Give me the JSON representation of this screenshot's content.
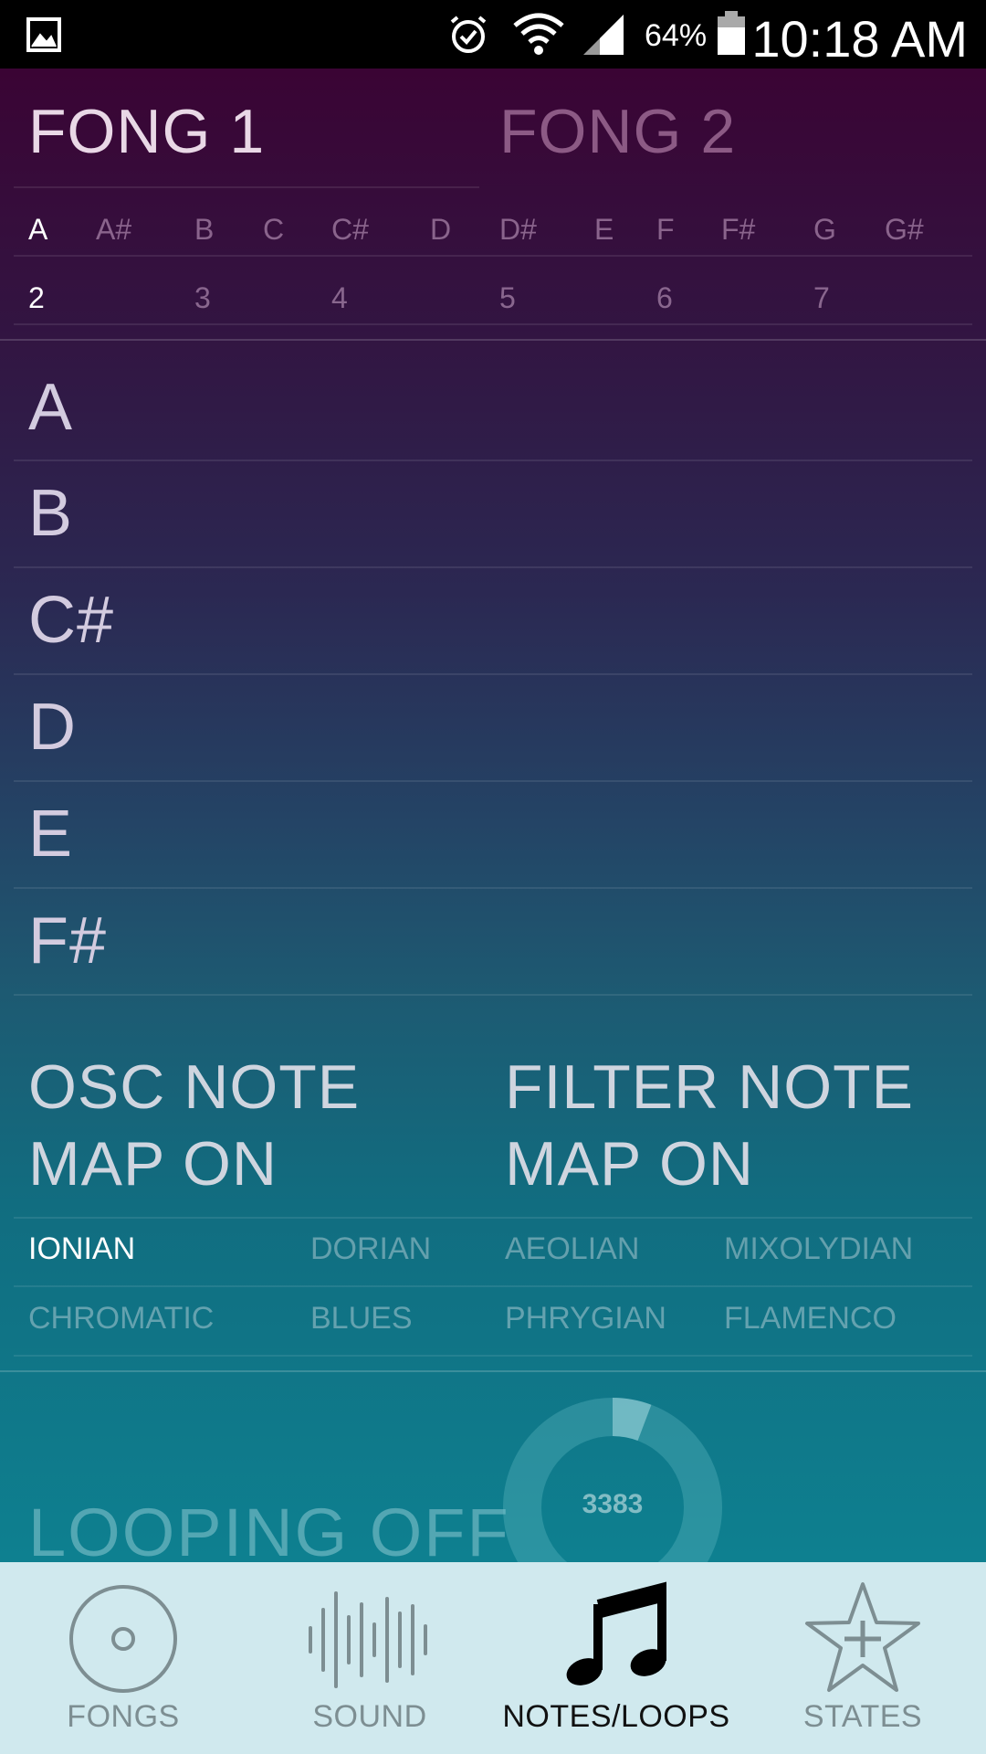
{
  "status_bar": {
    "battery_percent": "64%",
    "time": "10:18 AM"
  },
  "tabs": [
    {
      "label": "FONG 1",
      "selected": true
    },
    {
      "label": "FONG 2",
      "selected": false
    }
  ],
  "keys": [
    "A",
    "A#",
    "B",
    "C",
    "C#",
    "D",
    "D#",
    "E",
    "F",
    "F#",
    "G",
    "G#"
  ],
  "selected_key": "A",
  "octaves": [
    "2",
    "3",
    "4",
    "5",
    "6",
    "7"
  ],
  "selected_octave": "2",
  "notes": [
    "A",
    "B",
    "C#",
    "D",
    "E",
    "F#"
  ],
  "osc_note_map": {
    "line1": "OSC NOTE",
    "line2": "MAP ON"
  },
  "filter_note_map": {
    "line1": "FILTER NOTE",
    "line2": "MAP ON"
  },
  "modes": {
    "row1": [
      "IONIAN",
      "DORIAN",
      "AEOLIAN",
      "MIXOLYDIAN"
    ],
    "row2": [
      "CHROMATIC",
      "BLUES",
      "PHRYGIAN",
      "FLAMENCO"
    ],
    "selected": "IONIAN"
  },
  "looping_label": "LOOPING OFF",
  "dial_value": "3383",
  "nav": [
    {
      "label": "FONGS",
      "icon": "disc-icon",
      "active": false
    },
    {
      "label": "SOUND",
      "icon": "waveform-icon",
      "active": false
    },
    {
      "label": "NOTES/LOOPS",
      "icon": "music-note-icon",
      "active": true
    },
    {
      "label": "STATES",
      "icon": "star-plus-icon",
      "active": false
    }
  ],
  "colors": {
    "status_bar": "#000000",
    "nav_background": "#d0e9ee",
    "selected_text": "#ffffff",
    "gradient_top": "#3a0434",
    "gradient_bottom": "#0e8090"
  }
}
